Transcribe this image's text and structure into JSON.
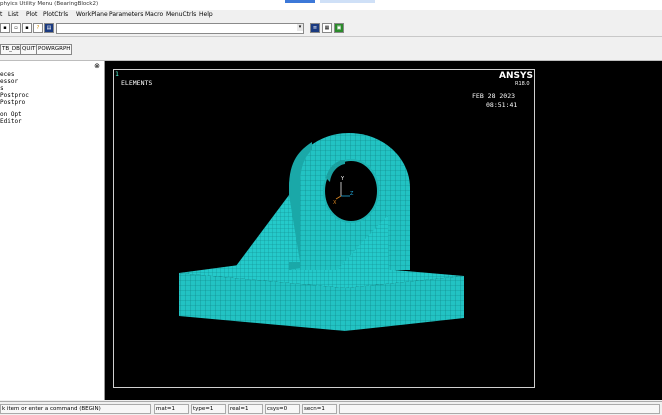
{
  "window": {
    "title": "phyics Utility Menu (BearingBlock2)"
  },
  "menu": {
    "items": [
      "t",
      "List",
      "Plot",
      "PlotCtrls",
      "WorkPlane",
      "Parameters",
      "Macro",
      "MenuCtrls",
      "Help"
    ]
  },
  "toolbar2": {
    "buttons": [
      "TB_DB",
      "QUIT",
      "POWRGRPH"
    ]
  },
  "left_panel": {
    "items": [
      "eces",
      "essor",
      "s",
      "Postproc",
      "Postpro",
      "on Opt",
      "Editor"
    ]
  },
  "graphics": {
    "window_number": "1",
    "plot_label": "ELEMENTS",
    "brand": "ANSYS",
    "version": "R18.0",
    "date": "FEB 28 2023",
    "time": "08:51:41",
    "axis_y": "Y",
    "axis_z": "Z",
    "axis_x": "X",
    "mesh_color": "#22c3c3",
    "background": "#000000"
  },
  "status": {
    "prompt": "k item or enter a command (BEGIN)",
    "mat": "mat=1",
    "type": "type=1",
    "real": "real=1",
    "csys": "csys=0",
    "secn": "secn=1"
  }
}
